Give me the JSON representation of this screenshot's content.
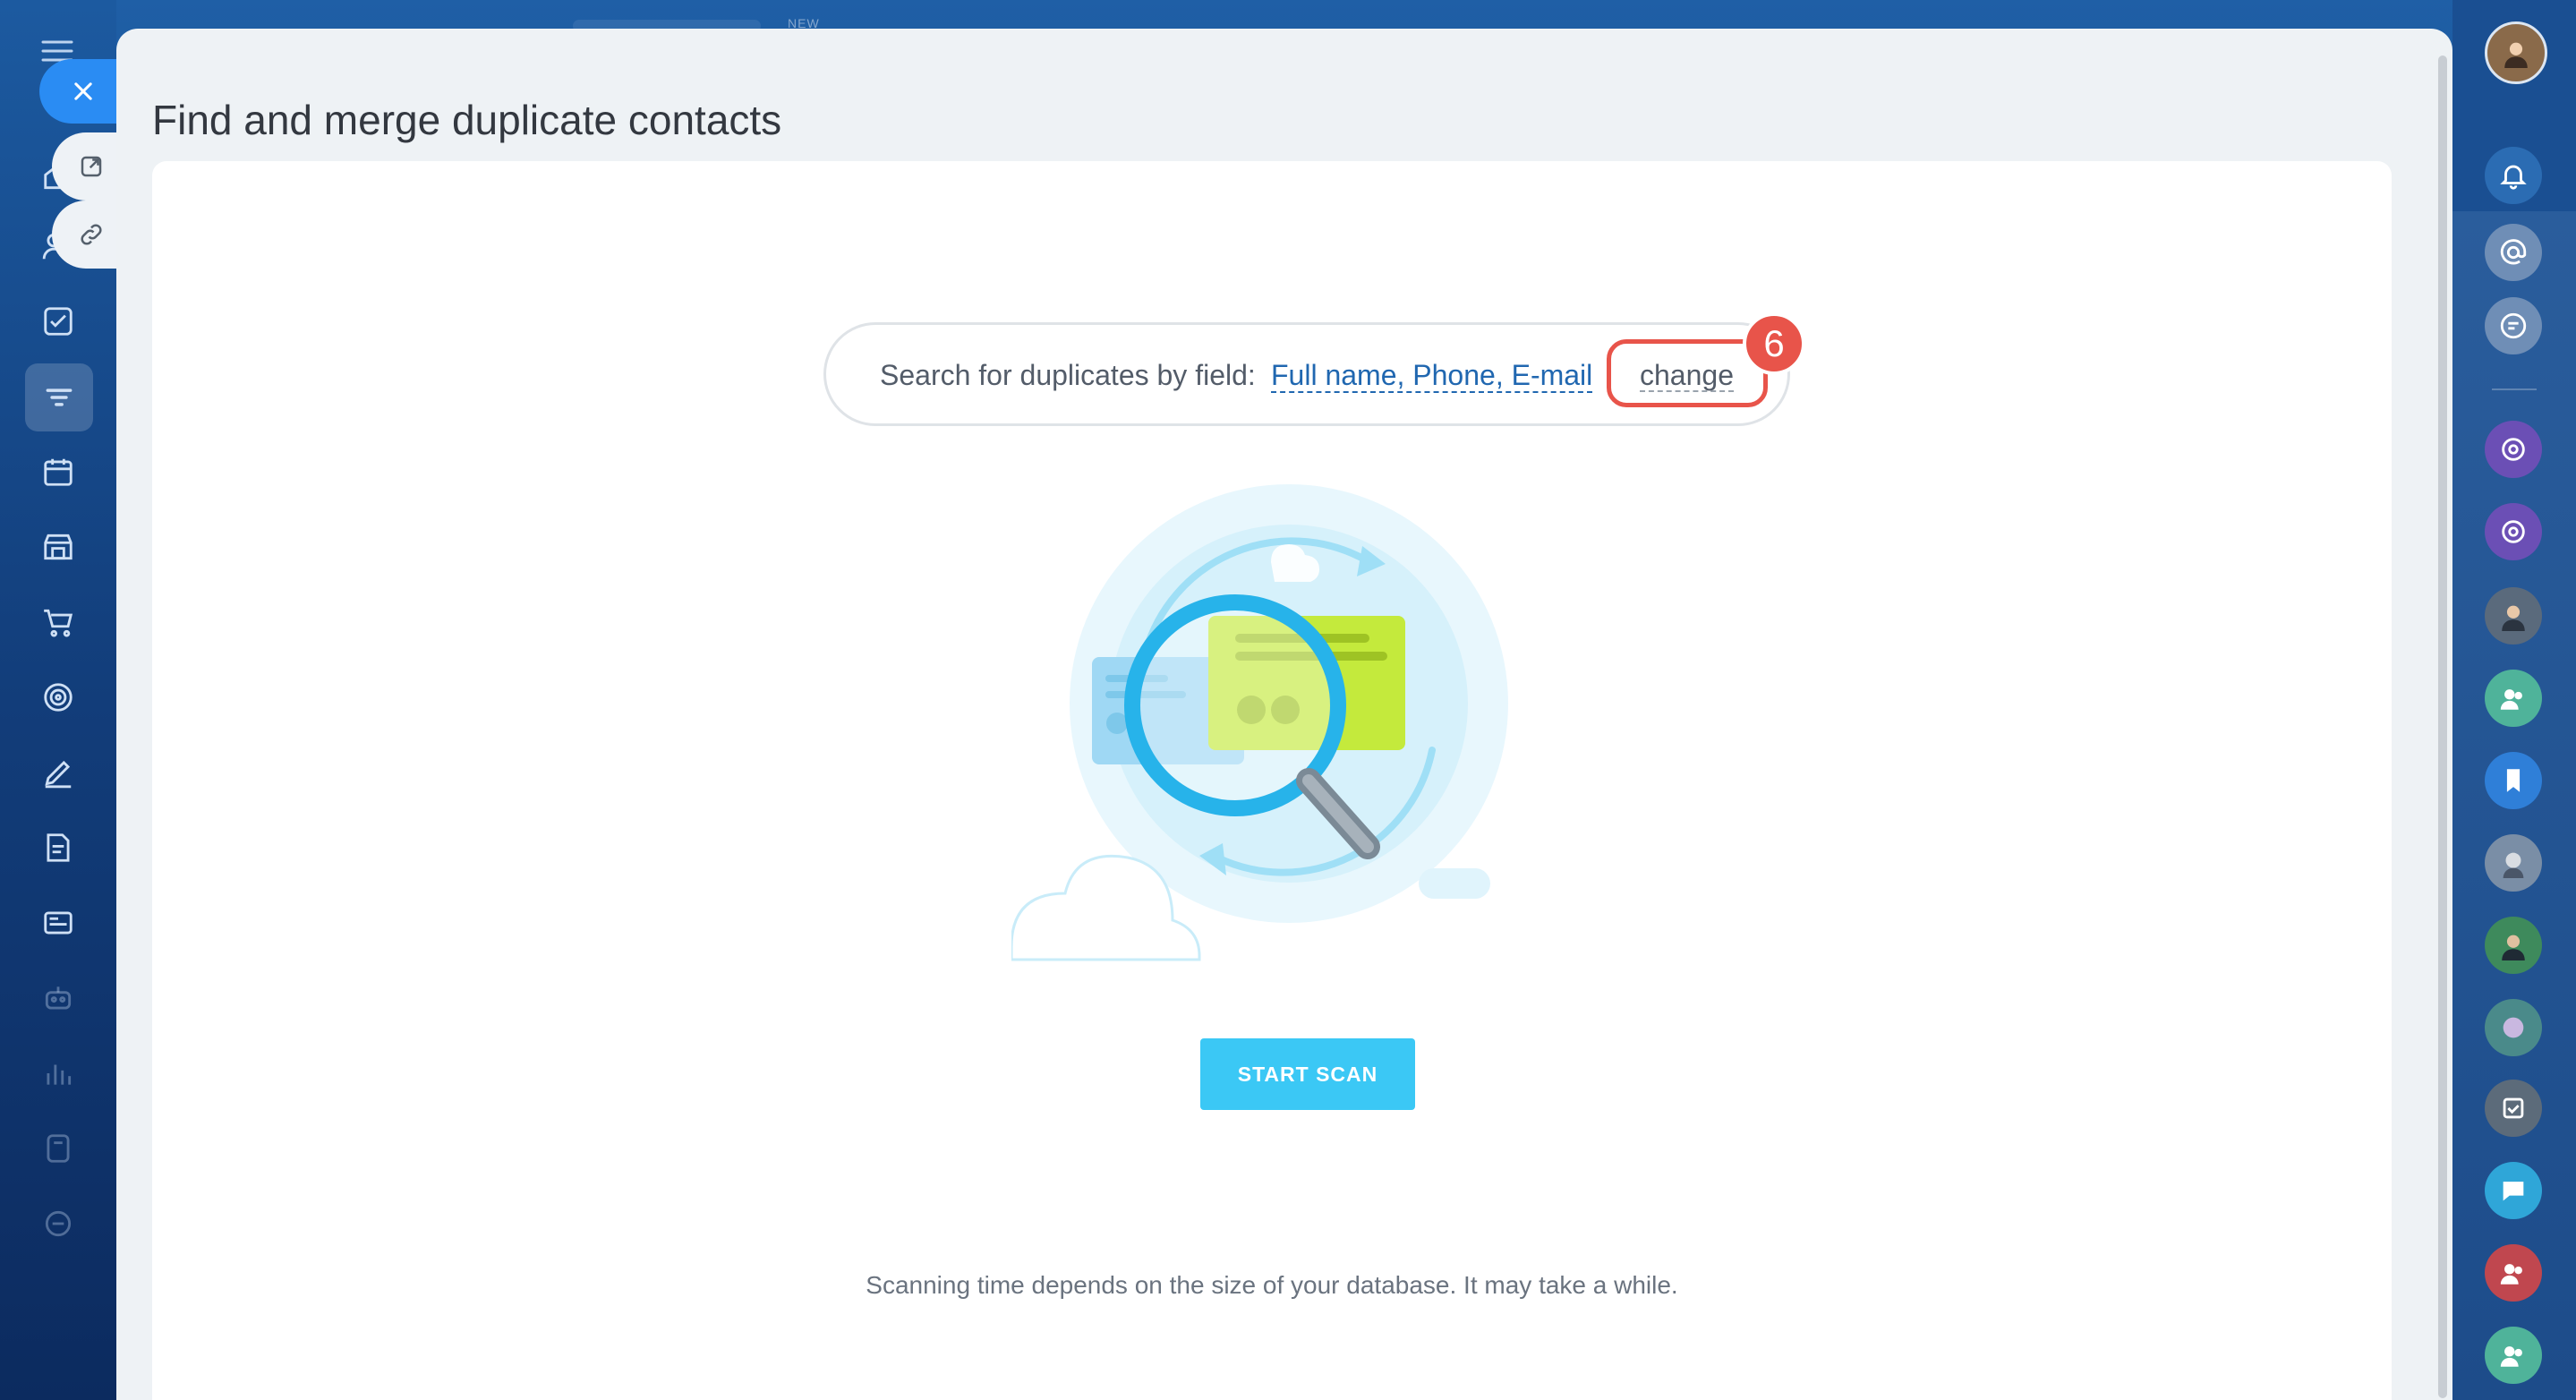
{
  "window": {
    "title": "Find and merge duplicate contacts",
    "top_tab_badge": "NEW"
  },
  "search": {
    "label": "Search for duplicates by field:",
    "fields": "Full name, Phone, E-mail",
    "change_link": "change",
    "step_badge": "6"
  },
  "actions": {
    "start_scan": "START SCAN"
  },
  "hint": "Scanning time depends on the size of your database. It may take a while.",
  "left_nav": {
    "icons": [
      "menu-icon",
      "home-icon",
      "users-icon",
      "tasks-icon",
      "crm-filter-icon",
      "calendar-icon",
      "store-icon",
      "cart-icon",
      "target-icon",
      "sign-icon",
      "documents-icon",
      "news-icon",
      "robot-icon",
      "analytics-icon",
      "scanner-icon",
      "box-icon"
    ]
  },
  "right_rail": {
    "icons": [
      "avatar",
      "bell-icon",
      "at-icon",
      "chat-search-icon",
      "openline-icon",
      "openline-icon",
      "avatar",
      "group-icon",
      "bookmark-icon",
      "avatar",
      "avatar",
      "avatar",
      "task-icon",
      "chat-icon",
      "group-icon",
      "group-icon"
    ]
  },
  "colors": {
    "accent": "#3bc8f5",
    "highlight": "#e8544a",
    "link": "#2067b0",
    "close": "#2a8cf3"
  }
}
